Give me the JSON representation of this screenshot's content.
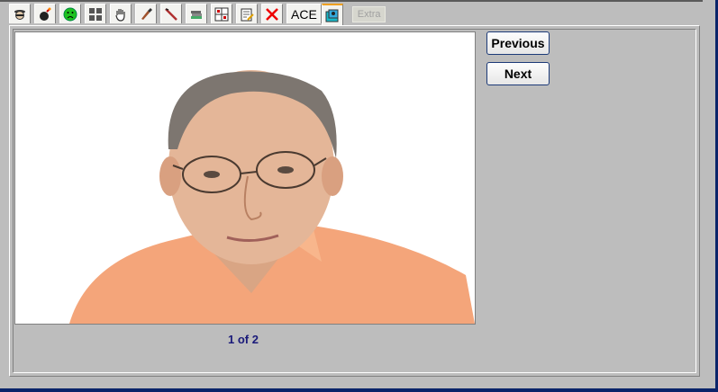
{
  "toolbar": {
    "tabs": [
      {
        "icon": "spy-face-icon"
      },
      {
        "icon": "bomb-icon"
      },
      {
        "icon": "sad-face-icon"
      },
      {
        "icon": "grid-faces-icon"
      },
      {
        "icon": "hand-icon"
      },
      {
        "icon": "paint-brush-icon"
      },
      {
        "icon": "pen-icon"
      },
      {
        "icon": "stack-books-icon"
      },
      {
        "icon": "chart-grid-icon"
      },
      {
        "icon": "note-edit-icon"
      },
      {
        "icon": "red-x-icon"
      }
    ],
    "ace_label": "ACE",
    "active_icon": "photo-icon",
    "extra_label": "Extra"
  },
  "viewer": {
    "previous_label": "Previous",
    "next_label": "Next",
    "counter": "1 of 2"
  },
  "colors": {
    "frame": "#0a246a",
    "panel": "#bdbdbd",
    "counter_text": "#1a1a7a",
    "shirt": "#f4a57a"
  }
}
